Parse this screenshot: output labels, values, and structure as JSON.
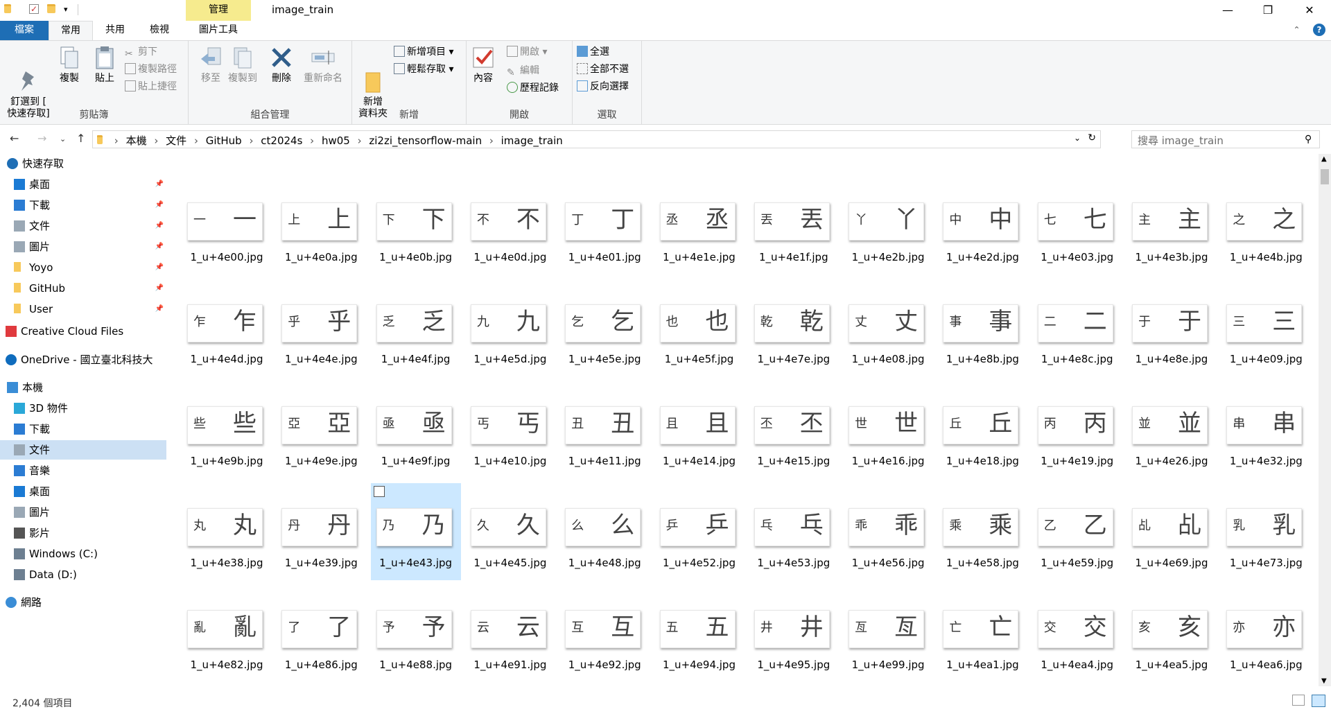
{
  "window": {
    "title": "image_train",
    "context_tab_group": "管理",
    "minimize": "—",
    "maximize": "❐",
    "close": "✕"
  },
  "tabs": [
    {
      "label": "檔案"
    },
    {
      "label": "常用"
    },
    {
      "label": "共用"
    },
    {
      "label": "檢視"
    },
    {
      "label": "圖片工具"
    }
  ],
  "ribbon": {
    "clipboard": {
      "label": "剪貼簿",
      "pin_label": "釘選到 [\n快速存取]",
      "copy": "複製",
      "paste": "貼上",
      "cut": "剪下",
      "copy_path": "複製路徑",
      "paste_shortcut": "貼上捷徑"
    },
    "organize": {
      "label": "組合管理",
      "move_to": "移至",
      "copy_to": "複製到",
      "delete": "刪除",
      "rename": "重新命名"
    },
    "new": {
      "label": "新增",
      "new_folder": "新增\n資料夾",
      "new_item": "新增項目",
      "easy_access": "輕鬆存取"
    },
    "open": {
      "label": "開啟",
      "properties": "內容",
      "open": "開啟",
      "edit": "編輯",
      "history": "歷程記錄"
    },
    "select": {
      "label": "選取",
      "select_all": "全選",
      "select_none": "全部不選",
      "invert": "反向選擇"
    }
  },
  "address": {
    "breadcrumb": [
      "本機",
      "文件",
      "GitHub",
      "ct2024s",
      "hw05",
      "zi2zi_tensorflow-main",
      "image_train"
    ],
    "search_placeholder": "搜尋 image_train"
  },
  "sidebar": {
    "items": [
      {
        "label": "快速存取",
        "icon": "star-icon"
      },
      {
        "label": "桌面",
        "icon": "desktop-icon",
        "pinned": true
      },
      {
        "label": "下載",
        "icon": "download-icon",
        "pinned": true
      },
      {
        "label": "文件",
        "icon": "document-icon",
        "pinned": true
      },
      {
        "label": "圖片",
        "icon": "pictures-icon",
        "pinned": true
      },
      {
        "label": "Yoyo",
        "icon": "folder-icon",
        "pinned": true
      },
      {
        "label": "GitHub",
        "icon": "folder-icon",
        "pinned": true
      },
      {
        "label": "User",
        "icon": "folder-icon",
        "pinned": true
      },
      {
        "label": "Creative Cloud Files",
        "icon": "creative-cloud-icon"
      },
      {
        "label": "OneDrive - 國立臺北科技大",
        "icon": "onedrive-icon"
      },
      {
        "label": "本機",
        "icon": "computer-icon"
      },
      {
        "label": "3D 物件",
        "icon": "3d-objects-icon"
      },
      {
        "label": "下載",
        "icon": "download-icon"
      },
      {
        "label": "文件",
        "icon": "document-icon",
        "selected": true
      },
      {
        "label": "音樂",
        "icon": "music-icon"
      },
      {
        "label": "桌面",
        "icon": "desktop-icon"
      },
      {
        "label": "圖片",
        "icon": "pictures-icon"
      },
      {
        "label": "影片",
        "icon": "video-icon"
      },
      {
        "label": "Windows (C:)",
        "icon": "drive-c-icon"
      },
      {
        "label": "Data (D:)",
        "icon": "drive-d-icon"
      },
      {
        "label": "網路",
        "icon": "network-icon"
      }
    ]
  },
  "files": [
    {
      "name": "1_u+4e00.jpg",
      "small": "一",
      "large": "一"
    },
    {
      "name": "1_u+4e0a.jpg",
      "small": "上",
      "large": "上"
    },
    {
      "name": "1_u+4e0b.jpg",
      "small": "下",
      "large": "下"
    },
    {
      "name": "1_u+4e0d.jpg",
      "small": "不",
      "large": "不"
    },
    {
      "name": "1_u+4e01.jpg",
      "small": "丁",
      "large": "丁"
    },
    {
      "name": "1_u+4e1e.jpg",
      "small": "丞",
      "large": "丞"
    },
    {
      "name": "1_u+4e1f.jpg",
      "small": "丟",
      "large": "丟"
    },
    {
      "name": "1_u+4e2b.jpg",
      "small": "丫",
      "large": "丫"
    },
    {
      "name": "1_u+4e2d.jpg",
      "small": "中",
      "large": "中"
    },
    {
      "name": "1_u+4e03.jpg",
      "small": "七",
      "large": "七"
    },
    {
      "name": "1_u+4e3b.jpg",
      "small": "主",
      "large": "主"
    },
    {
      "name": "1_u+4e4b.jpg",
      "small": "之",
      "large": "之"
    },
    {
      "name": "1_u+4e4d.jpg",
      "small": "乍",
      "large": "乍"
    },
    {
      "name": "1_u+4e4e.jpg",
      "small": "乎",
      "large": "乎"
    },
    {
      "name": "1_u+4e4f.jpg",
      "small": "乏",
      "large": "乏"
    },
    {
      "name": "1_u+4e5d.jpg",
      "small": "九",
      "large": "九"
    },
    {
      "name": "1_u+4e5e.jpg",
      "small": "乞",
      "large": "乞"
    },
    {
      "name": "1_u+4e5f.jpg",
      "small": "也",
      "large": "也"
    },
    {
      "name": "1_u+4e7e.jpg",
      "small": "乾",
      "large": "乾"
    },
    {
      "name": "1_u+4e08.jpg",
      "small": "丈",
      "large": "丈"
    },
    {
      "name": "1_u+4e8b.jpg",
      "small": "事",
      "large": "事"
    },
    {
      "name": "1_u+4e8c.jpg",
      "small": "二",
      "large": "二"
    },
    {
      "name": "1_u+4e8e.jpg",
      "small": "于",
      "large": "于"
    },
    {
      "name": "1_u+4e09.jpg",
      "small": "三",
      "large": "三"
    },
    {
      "name": "1_u+4e9b.jpg",
      "small": "些",
      "large": "些"
    },
    {
      "name": "1_u+4e9e.jpg",
      "small": "亞",
      "large": "亞"
    },
    {
      "name": "1_u+4e9f.jpg",
      "small": "亟",
      "large": "亟"
    },
    {
      "name": "1_u+4e10.jpg",
      "small": "丐",
      "large": "丐"
    },
    {
      "name": "1_u+4e11.jpg",
      "small": "丑",
      "large": "丑"
    },
    {
      "name": "1_u+4e14.jpg",
      "small": "且",
      "large": "且"
    },
    {
      "name": "1_u+4e15.jpg",
      "small": "丕",
      "large": "丕"
    },
    {
      "name": "1_u+4e16.jpg",
      "small": "世",
      "large": "世"
    },
    {
      "name": "1_u+4e18.jpg",
      "small": "丘",
      "large": "丘"
    },
    {
      "name": "1_u+4e19.jpg",
      "small": "丙",
      "large": "丙"
    },
    {
      "name": "1_u+4e26.jpg",
      "small": "並",
      "large": "並"
    },
    {
      "name": "1_u+4e32.jpg",
      "small": "串",
      "large": "串"
    },
    {
      "name": "1_u+4e38.jpg",
      "small": "丸",
      "large": "丸"
    },
    {
      "name": "1_u+4e39.jpg",
      "small": "丹",
      "large": "丹"
    },
    {
      "name": "1_u+4e43.jpg",
      "small": "乃",
      "large": "乃",
      "selected": true
    },
    {
      "name": "1_u+4e45.jpg",
      "small": "久",
      "large": "久"
    },
    {
      "name": "1_u+4e48.jpg",
      "small": "么",
      "large": "么"
    },
    {
      "name": "1_u+4e52.jpg",
      "small": "乒",
      "large": "乒"
    },
    {
      "name": "1_u+4e53.jpg",
      "small": "乓",
      "large": "乓"
    },
    {
      "name": "1_u+4e56.jpg",
      "small": "乖",
      "large": "乖"
    },
    {
      "name": "1_u+4e58.jpg",
      "small": "乘",
      "large": "乘"
    },
    {
      "name": "1_u+4e59.jpg",
      "small": "乙",
      "large": "乙"
    },
    {
      "name": "1_u+4e69.jpg",
      "small": "乩",
      "large": "乩"
    },
    {
      "name": "1_u+4e73.jpg",
      "small": "乳",
      "large": "乳"
    },
    {
      "name": "1_u+4e82.jpg",
      "small": "亂",
      "large": "亂"
    },
    {
      "name": "1_u+4e86.jpg",
      "small": "了",
      "large": "了"
    },
    {
      "name": "1_u+4e88.jpg",
      "small": "予",
      "large": "予"
    },
    {
      "name": "1_u+4e91.jpg",
      "small": "云",
      "large": "云"
    },
    {
      "name": "1_u+4e92.jpg",
      "small": "互",
      "large": "互"
    },
    {
      "name": "1_u+4e94.jpg",
      "small": "五",
      "large": "五"
    },
    {
      "name": "1_u+4e95.jpg",
      "small": "井",
      "large": "井"
    },
    {
      "name": "1_u+4e99.jpg",
      "small": "亙",
      "large": "亙"
    },
    {
      "name": "1_u+4ea1.jpg",
      "small": "亡",
      "large": "亡"
    },
    {
      "name": "1_u+4ea4.jpg",
      "small": "交",
      "large": "交"
    },
    {
      "name": "1_u+4ea5.jpg",
      "small": "亥",
      "large": "亥"
    },
    {
      "name": "1_u+4ea6.jpg",
      "small": "亦",
      "large": "亦"
    }
  ],
  "status": {
    "item_count": "2,404 個項目"
  },
  "colors": {
    "file_tab": "#1e6eb5",
    "context_tab": "#f6eb8e",
    "selection": "#cce8ff",
    "nav_selection": "#cce0f4"
  }
}
